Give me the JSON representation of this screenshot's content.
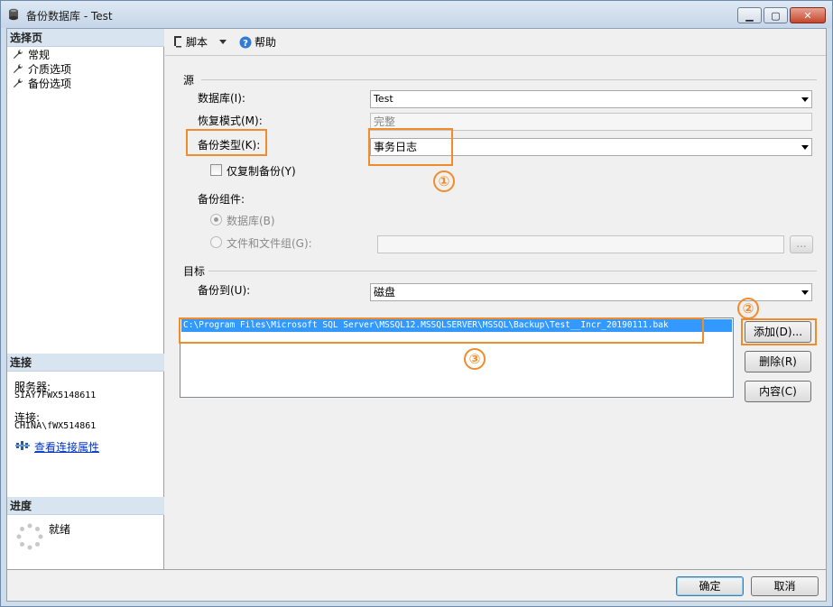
{
  "window": {
    "title": "备份数据库 - Test"
  },
  "left": {
    "select_page_header": "选择页",
    "pages": [
      "常规",
      "介质选项",
      "备份选项"
    ],
    "connection_header": "连接",
    "server_label": "服务器:",
    "server_value": "SIAY7FWX5148611",
    "connection_label": "连接:",
    "connection_value": "CHINA\\fWX514861",
    "view_props_link": "查看连接属性",
    "progress_header": "进度",
    "progress_status": "就绪"
  },
  "toolbar": {
    "script": "脚本",
    "help": "帮助"
  },
  "source": {
    "group_label": "源",
    "database_label": "数据库(I):",
    "database_value": "Test",
    "recovery_label": "恢复模式(M):",
    "recovery_value": "完整",
    "backup_type_label": "备份类型(K):",
    "backup_type_value": "事务日志",
    "copy_only_label": "仅复制备份(Y)",
    "component_label": "备份组件:",
    "component_db": "数据库(B)",
    "component_files": "文件和文件组(G):",
    "browse_label": "..."
  },
  "destination": {
    "group_label": "目标",
    "backup_to_label": "备份到(U):",
    "backup_to_value": "磁盘",
    "paths": [
      "C:\\Program Files\\Microsoft SQL Server\\MSSQL12.MSSQLSERVER\\MSSQL\\Backup\\Test__Incr_20190111.bak"
    ],
    "add_button": "添加(D)...",
    "remove_button": "删除(R)",
    "contents_button": "内容(C)"
  },
  "footer": {
    "ok": "确定",
    "cancel": "取消"
  },
  "annotations": {
    "one": "①",
    "two": "②",
    "three": "③",
    "color": "#f08c2c"
  }
}
